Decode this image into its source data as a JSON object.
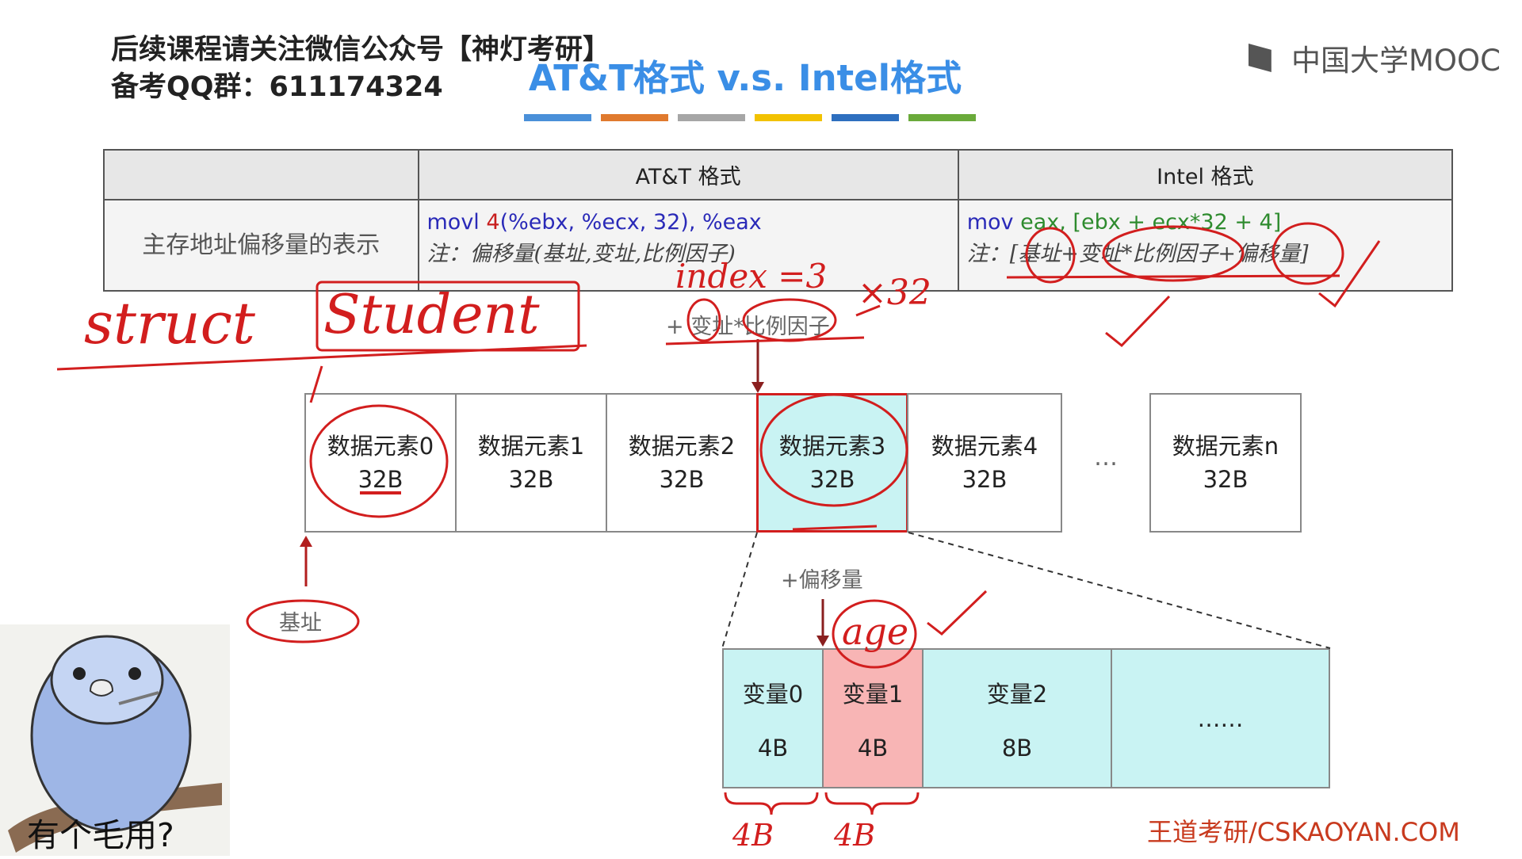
{
  "header": {
    "promo_line1": "后续课程请关注微信公众号【神灯考研】",
    "promo_line2": "备考QQ群：611174324"
  },
  "slide": {
    "title": "AT&T格式 v.s. Intel格式",
    "title_bar_colors": [
      "#4a90d9",
      "#e07a2e",
      "#a6a6a6",
      "#f2c200",
      "#2e6fbf",
      "#6aaa3a"
    ]
  },
  "logo": {
    "text": "中国大学MOOC"
  },
  "table": {
    "header": [
      "",
      "AT&T 格式",
      "Intel 格式"
    ],
    "row_label": "主存地址偏移量的表示",
    "att": {
      "code_mnemonic": "movl",
      "code_offset": "4",
      "code_operands": "(%ebx, %ecx, 32), %eax",
      "note": "注：偏移量(基址,变址,比例因子)"
    },
    "intel": {
      "code_mnemonic": "mov",
      "code_reg": "eax,",
      "code_mem": "[ebx + ecx*32 + 4]",
      "note": "注：[基址+变址*比例因子+偏移量]"
    }
  },
  "array": {
    "index_label": "+ 变址*比例因子",
    "elements": [
      {
        "name": "数据元素0",
        "size": "32B"
      },
      {
        "name": "数据元素1",
        "size": "32B"
      },
      {
        "name": "数据元素2",
        "size": "32B"
      },
      {
        "name": "数据元素3",
        "size": "32B"
      },
      {
        "name": "数据元素4",
        "size": "32B"
      },
      {
        "name": "数据元素n",
        "size": "32B"
      }
    ],
    "ellipsis": "…",
    "base_label": "基址",
    "offset_label": "+偏移量"
  },
  "struct_fields": [
    {
      "name": "变量0",
      "size": "4B"
    },
    {
      "name": "变量1",
      "size": "4B"
    },
    {
      "name": "变量2",
      "size": "8B"
    },
    {
      "name": "……",
      "size": ""
    }
  ],
  "handwriting": {
    "struct": "struct",
    "student": "Student",
    "index": "index =3",
    "times": "×32",
    "age": "age",
    "brace1": "4B",
    "brace2": "4B"
  },
  "meme": {
    "caption": "有个毛用?"
  },
  "footer": {
    "brand": "王道考研/CSKAOYAN.COM"
  }
}
